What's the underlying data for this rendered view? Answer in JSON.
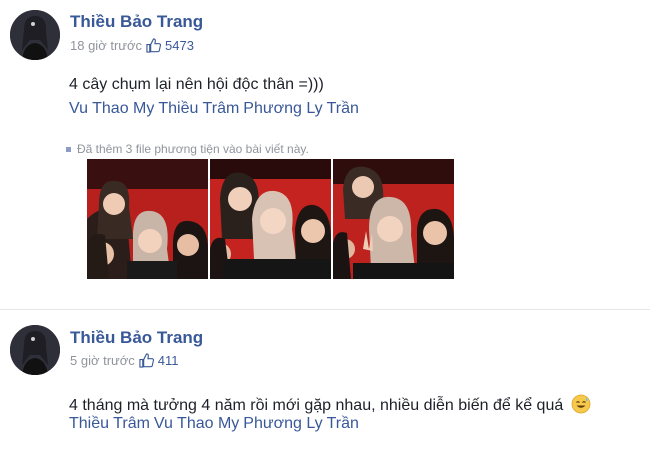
{
  "posts": [
    {
      "author": "Thiều Bảo Trang",
      "time": "18 giờ trước",
      "likes": "5473",
      "text": "4 cây chụm lại nên hội độc thân =)))",
      "tags": [
        "Vu Thao My",
        "Thiều Trâm",
        "Phương Ly",
        "Trần"
      ],
      "media_note": "Đã thêm 3 file phương tiện vào bài viết này.",
      "photos": [
        "selfie-photo-1",
        "selfie-photo-2",
        "selfie-photo-3"
      ]
    },
    {
      "author": "Thiều Bảo Trang",
      "time": "5 giờ trước",
      "likes": "411",
      "text": "4 tháng mà tưởng 4 năm rồi mới gặp nhau, nhiều diễn biến để kể quá",
      "tags": [
        "Thiều Trâm",
        "Vu Thao My",
        "Phương Ly",
        "Trần"
      ]
    }
  ],
  "colors": {
    "link": "#385898",
    "meta": "#90949c",
    "like": "#3b5998",
    "photo_background": "#c0231f"
  },
  "icons": {
    "like": "thumbs-up-icon",
    "emoji": "sweat-smile-emoji-icon",
    "bullet": "square-bullet-icon"
  }
}
